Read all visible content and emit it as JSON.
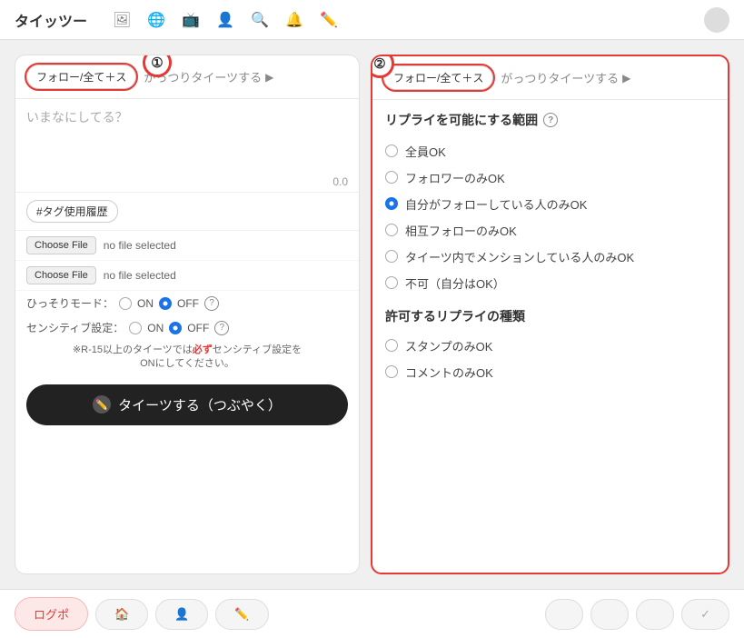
{
  "app": {
    "title": "タイッツー"
  },
  "nav": {
    "logo": "タイッツー",
    "icons": [
      "🖼",
      "🌐",
      "📺",
      "👤",
      "🔍",
      "🔔",
      "✏️"
    ]
  },
  "annotation": {
    "circle1": "①",
    "circle2": "②"
  },
  "left_panel": {
    "follow_btn": "フォロー/全て＋ス",
    "gatten_btn": "がっつりタイーツする",
    "tweet_placeholder": "いまなにしてる？",
    "counter": "0.0",
    "hashtag_btn": "#タグ使用履歴",
    "file1_btn": "Choose File",
    "file1_text": "no file selected",
    "file2_btn": "Choose File",
    "file2_text": "no file selected",
    "hissori_label": "ひっそりモード：",
    "on_label": "ON",
    "off_label": "OFF",
    "sensitive_label": "センシティブ設定：",
    "warning1": "※R-15以上のタイーツでは",
    "warning_required": "必ず",
    "warning2": "センシティブ設定を",
    "warning3": "ONにしてください。",
    "submit_btn": "タイーツする（つぶやく）"
  },
  "right_panel": {
    "follow_btn": "フォロー/全て＋ス",
    "gatten_btn": "がっつりタイーツする",
    "section1_title": "リプライを可能にする範囲",
    "section1_help": "?",
    "options": [
      {
        "label": "全員OK",
        "selected": false
      },
      {
        "label": "フォロワーのみOK",
        "selected": false
      },
      {
        "label": "自分がフォローしている人のみOK",
        "selected": true
      },
      {
        "label": "相互フォローのみOK",
        "selected": false
      },
      {
        "label": "タイーツ内でメンションしている人のみOK",
        "selected": false
      },
      {
        "label": "不可（自分はOK）",
        "selected": false
      }
    ],
    "section2_title": "許可するリプライの種類",
    "type_options": [
      {
        "label": "スタンプのみOK",
        "selected": false
      },
      {
        "label": "コメントのみOK",
        "selected": false
      }
    ]
  },
  "bottom_nav": {
    "logopo_btn": "ログポ",
    "home_icon": "🏠",
    "user_icon": "👤",
    "edit_icon": "✏️",
    "right_btns": [
      "",
      "",
      "",
      "✓"
    ]
  }
}
